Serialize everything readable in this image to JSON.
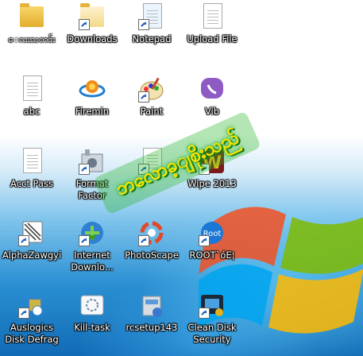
{
  "desktop": {
    "icons": [
      {
        "label": "ေလးသတင်း",
        "icon": "folder-icon"
      },
      {
        "label": "Downloads",
        "icon": "downloads-folder-icon"
      },
      {
        "label": "Notepad",
        "icon": "notepad-icon"
      },
      {
        "label": "Upload File",
        "icon": "document-icon"
      },
      {
        "label": "abc",
        "icon": "document-icon"
      },
      {
        "label": "Firemin",
        "icon": "firemin-icon"
      },
      {
        "label": "Paint",
        "icon": "paint-icon"
      },
      {
        "label": "Vib",
        "icon": "viber-icon"
      },
      {
        "label": "Acct Pass",
        "icon": "document-icon"
      },
      {
        "label": "Format Factor",
        "icon": "format-factory-icon"
      },
      {
        "label": "",
        "icon": "document-icon"
      },
      {
        "label": "Wipe 2013",
        "icon": "wipe-icon"
      },
      {
        "label": "AlphaZawgyi",
        "icon": "alphazawgyi-icon"
      },
      {
        "label": "Internet Downlo...",
        "icon": "idm-icon"
      },
      {
        "label": "PhotoScape",
        "icon": "photoscape-icon"
      },
      {
        "label": "ROOT`óE¦",
        "icon": "root-icon"
      },
      {
        "label": "Auslogics Disk Defrag",
        "icon": "auslogics-icon"
      },
      {
        "label": "Kill-task",
        "icon": "kill-task-icon"
      },
      {
        "label": "rcsetup143",
        "icon": "installer-icon"
      },
      {
        "label": "Clean Disk Security",
        "icon": "clean-disk-icon"
      }
    ],
    "watermark": "ဘလောခ့ျစိုးသည်"
  },
  "colors": {
    "desktop_blue": "#2a8fd2",
    "logo_red": "#f25022",
    "logo_green": "#7fba00",
    "logo_blue": "#00a4ef",
    "logo_yellow": "#ffb900"
  }
}
